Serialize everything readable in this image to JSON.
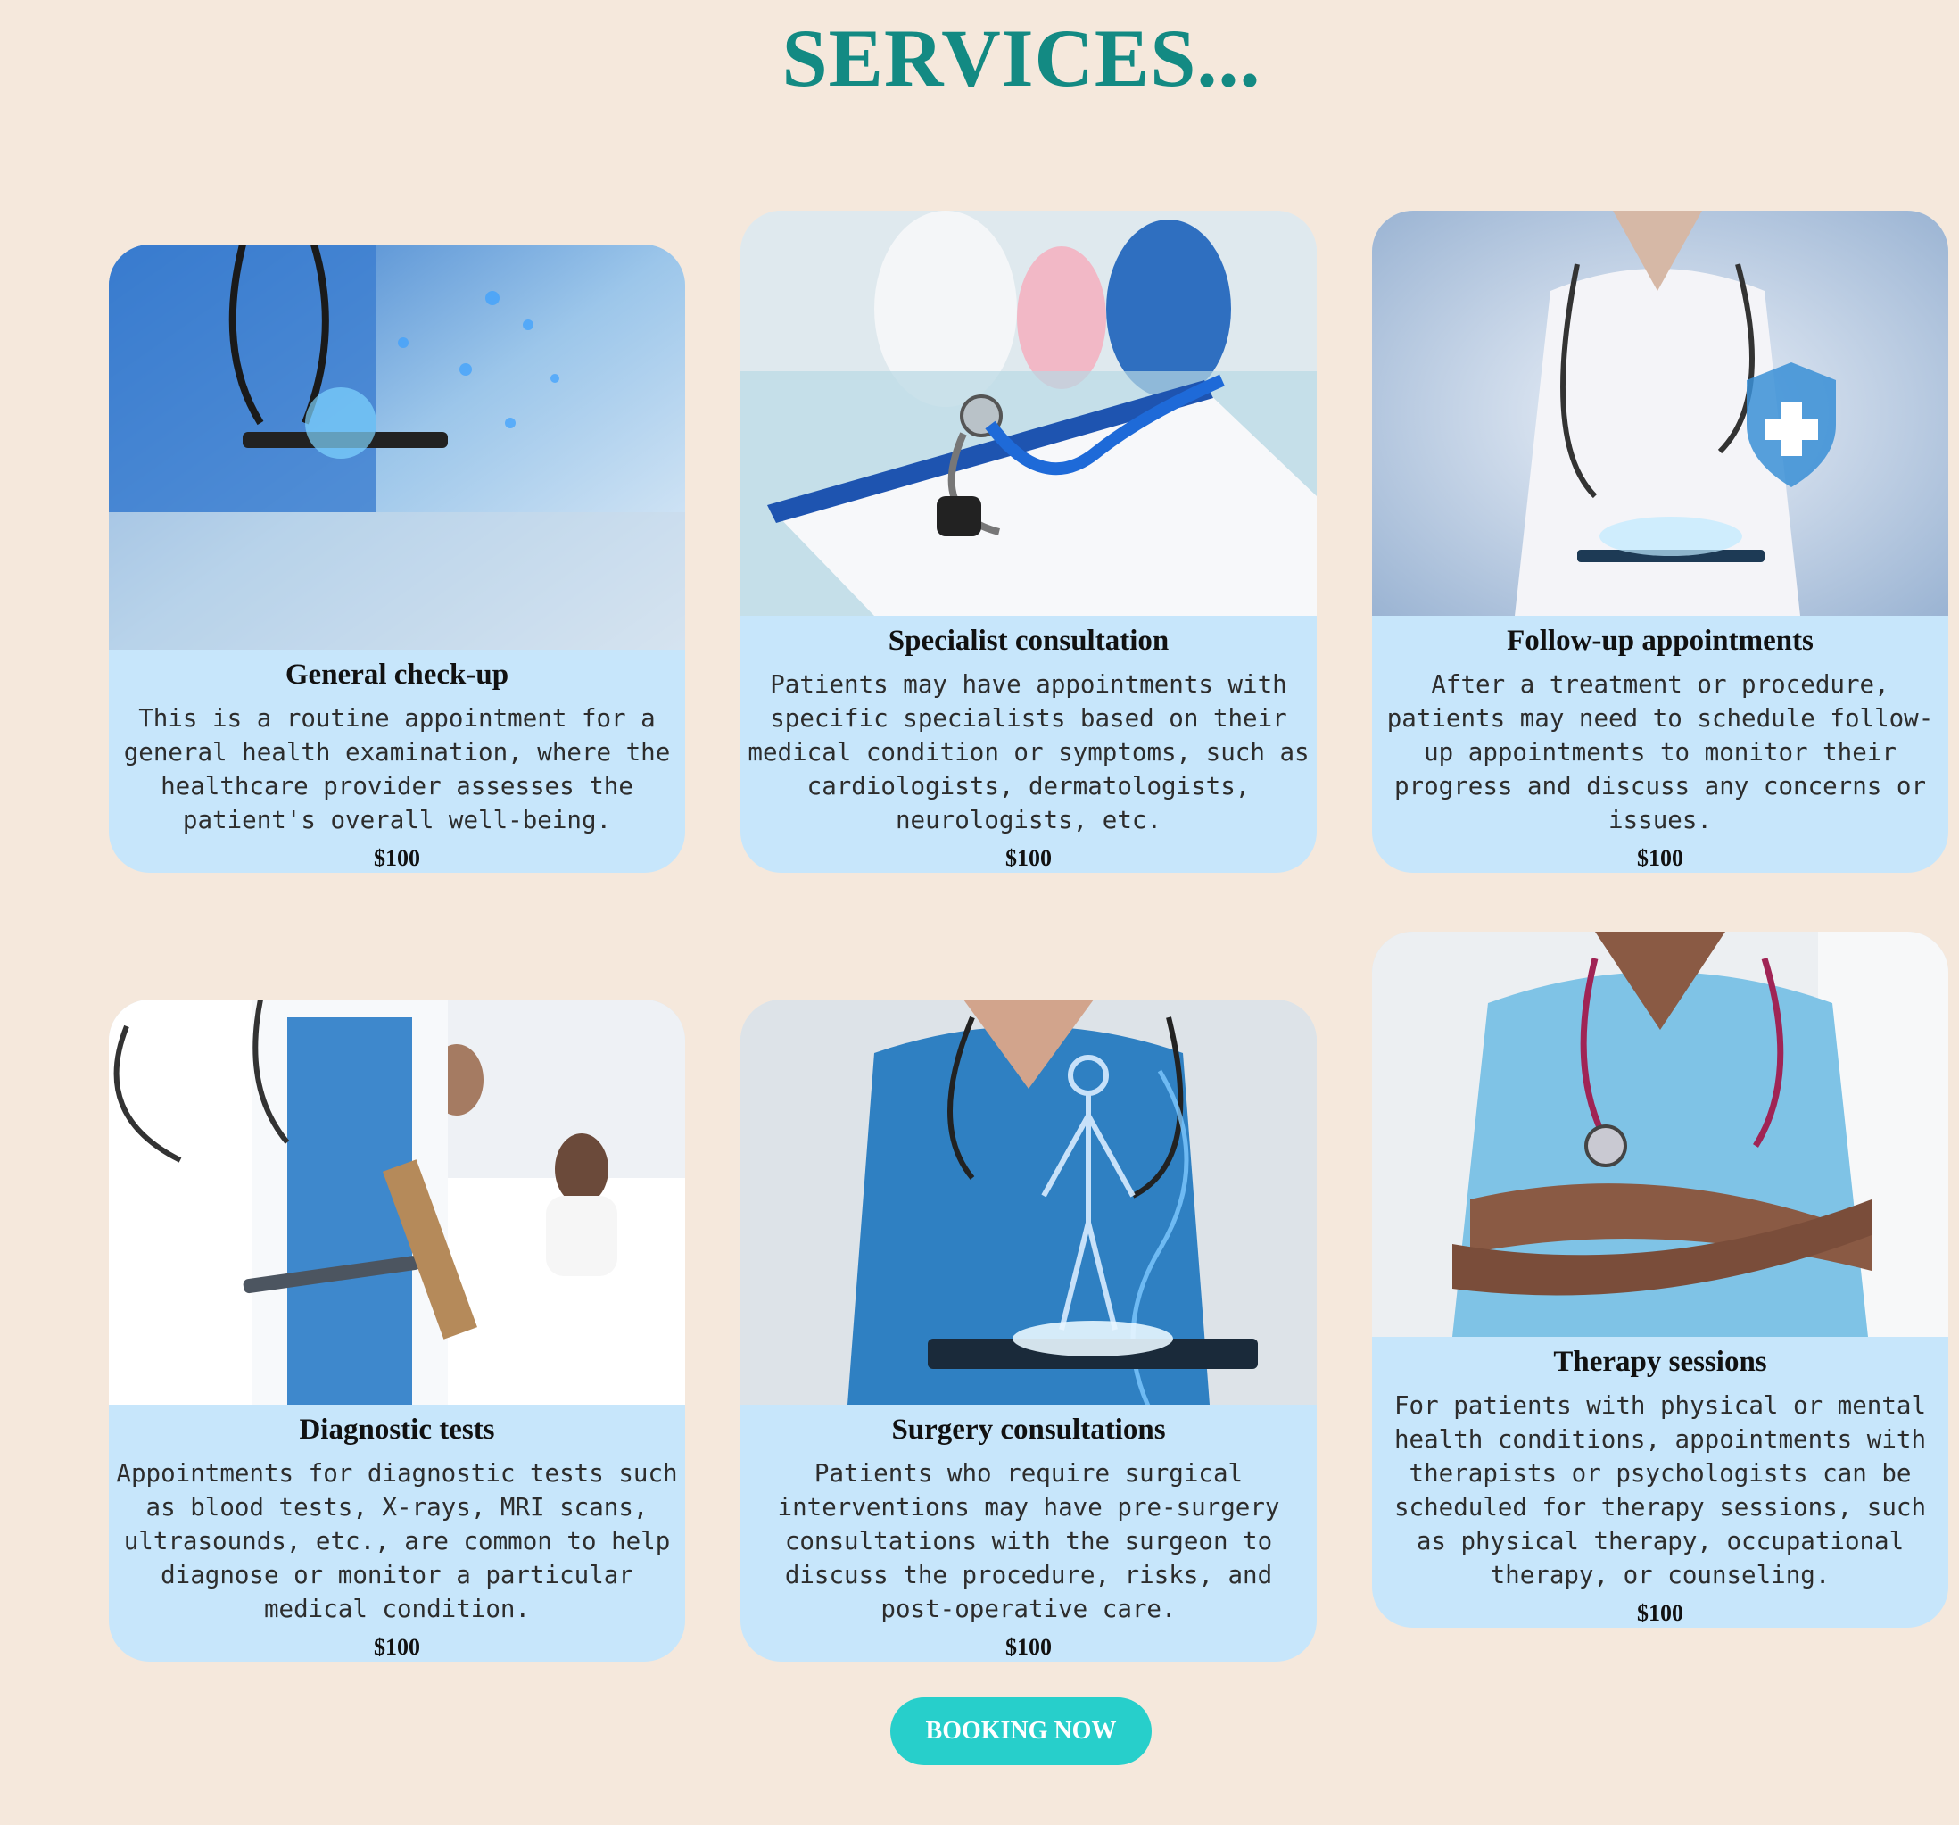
{
  "page": {
    "title": "SERVICES..."
  },
  "services": [
    {
      "title": "General check-up",
      "description": "This is a routine appointment for a general health examination, where the healthcare provider assesses the patient's overall well-being.",
      "price": "$100",
      "image_icon": "doctor-with-tablet-image"
    },
    {
      "title": "Specialist consultation",
      "description": "Patients may have appointments with specific specialists based on their medical condition or symptoms, such as cardiologists, dermatologists, neurologists, etc.",
      "price": "$100",
      "image_icon": "stethoscope-on-clipboard-image"
    },
    {
      "title": "Follow-up appointments",
      "description": "After a treatment or procedure, patients may need to schedule follow-up appointments to monitor their progress and discuss any concerns or issues.",
      "price": "$100",
      "image_icon": "doctor-holographic-shield-image"
    },
    {
      "title": "Diagnostic tests",
      "description": "Appointments for diagnostic tests such as blood tests, X-rays, MRI scans, ultrasounds, etc., are common to help diagnose or monitor a particular medical condition.",
      "price": "$100",
      "image_icon": "doctors-with-patient-image"
    },
    {
      "title": "Surgery consultations",
      "description": "Patients who require surgical interventions may have pre-surgery consultations with the surgeon to discuss the procedure, risks, and post-operative care.",
      "price": "$100",
      "image_icon": "hologram-body-image"
    },
    {
      "title": "Therapy sessions",
      "description": "For patients with physical or mental health conditions, appointments with therapists or psychologists can be scheduled for therapy sessions, such as physical therapy, occupational therapy, or counseling.",
      "price": "$100",
      "image_icon": "nurse-arms-crossed-image"
    }
  ],
  "booking": {
    "label": "BOOKING NOW"
  },
  "colors": {
    "background": "#f5e8dc",
    "title": "#138a83",
    "card": "#c7e6fb",
    "button": "#27cfcb"
  }
}
